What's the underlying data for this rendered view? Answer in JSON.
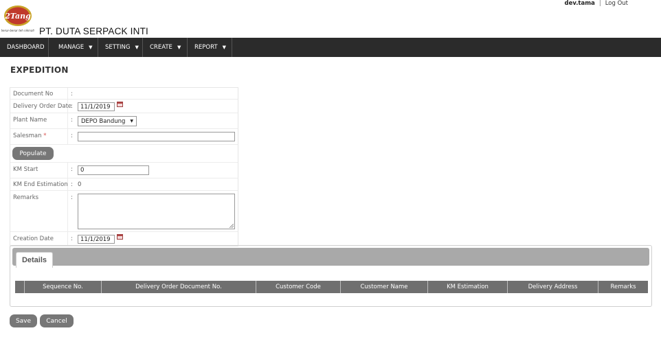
{
  "header": {
    "company_name": "PT. DUTA SERPACK INTI",
    "username": "dev.tama",
    "separator": "|",
    "logout_label": "Log Out",
    "logo": {
      "text": "2Tang",
      "tagline": "benar-benar teh nikmat!"
    }
  },
  "nav": {
    "items": [
      {
        "label": "DASHBOARD",
        "dropdown": false
      },
      {
        "label": "MANAGE",
        "dropdown": true
      },
      {
        "label": "SETTING",
        "dropdown": true
      },
      {
        "label": "CREATE",
        "dropdown": true
      },
      {
        "label": "REPORT",
        "dropdown": true
      }
    ],
    "caret": "▼"
  },
  "page": {
    "title": "EXPEDITION"
  },
  "form": {
    "colon": ":",
    "document_no": {
      "label": "Document No",
      "value": ""
    },
    "delivery_order_date": {
      "label": "Delivery Order Date",
      "value": "11/1/2019"
    },
    "plant_name": {
      "label": "Plant Name",
      "value": "DEPO Bandung"
    },
    "salesman": {
      "label": "Salesman",
      "required_mark": "*",
      "value": ""
    },
    "populate_button": "Populate",
    "km_start": {
      "label": "KM Start",
      "value": "0"
    },
    "km_end_estimation": {
      "label": "KM End Estimation",
      "value": "0"
    },
    "remarks": {
      "label": "Remarks",
      "value": ""
    },
    "creation_date": {
      "label": "Creation Date",
      "value": "11/1/2019"
    }
  },
  "details": {
    "tab_label": "Details",
    "columns": [
      "Sequence No.",
      "Delivery Order Document No.",
      "Customer Code",
      "Customer Name",
      "KM Estimation",
      "Delivery Address",
      "Remarks"
    ],
    "rows": []
  },
  "actions": {
    "save": "Save",
    "cancel": "Cancel"
  },
  "colors": {
    "nav_bg": "#2b2b2b",
    "button_bg": "#777777",
    "table_header_bg": "#6f6f6f",
    "tab_bar_bg": "#a9a9a9",
    "required": "#d9534f"
  }
}
